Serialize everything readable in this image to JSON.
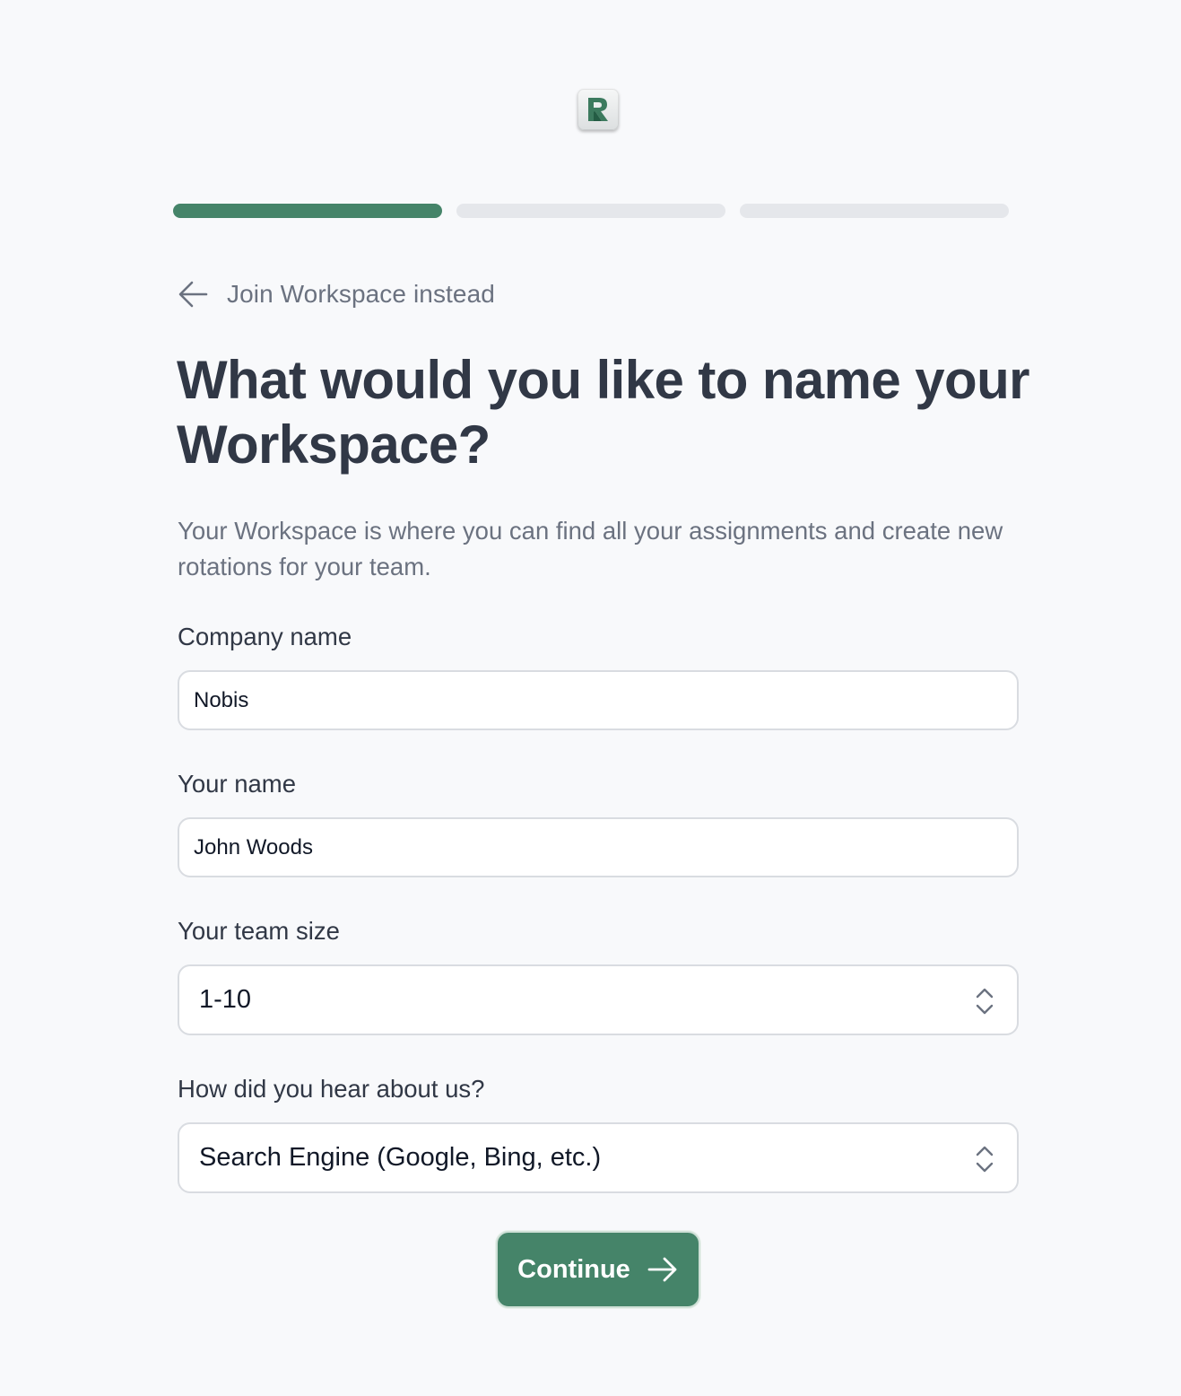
{
  "app": {
    "logo_icon": "workspace-r-logo-icon"
  },
  "progress": {
    "total_steps": 3,
    "current_step": 1,
    "accent_color": "#458469",
    "inactive_color": "#e5e7eb"
  },
  "back_link": {
    "label": "Join Workspace instead",
    "icon": "arrow-left-icon"
  },
  "heading": {
    "title": "What would you like to name your Workspace?",
    "description": "Your Workspace is where you can find all your assignments and create new rotations for your team."
  },
  "form": {
    "company_name": {
      "label": "Company name",
      "value": "Nobis"
    },
    "your_name": {
      "label": "Your name",
      "value": "John Woods"
    },
    "team_size": {
      "label": "Your team size",
      "selected": "1-10",
      "icon": "chevron-up-down-icon"
    },
    "referral_source": {
      "label": "How did you hear about us?",
      "selected": "Search Engine (Google, Bing, etc.)",
      "icon": "chevron-up-down-icon"
    }
  },
  "actions": {
    "continue_label": "Continue",
    "continue_icon": "arrow-right-icon",
    "button_color": "#458469"
  }
}
